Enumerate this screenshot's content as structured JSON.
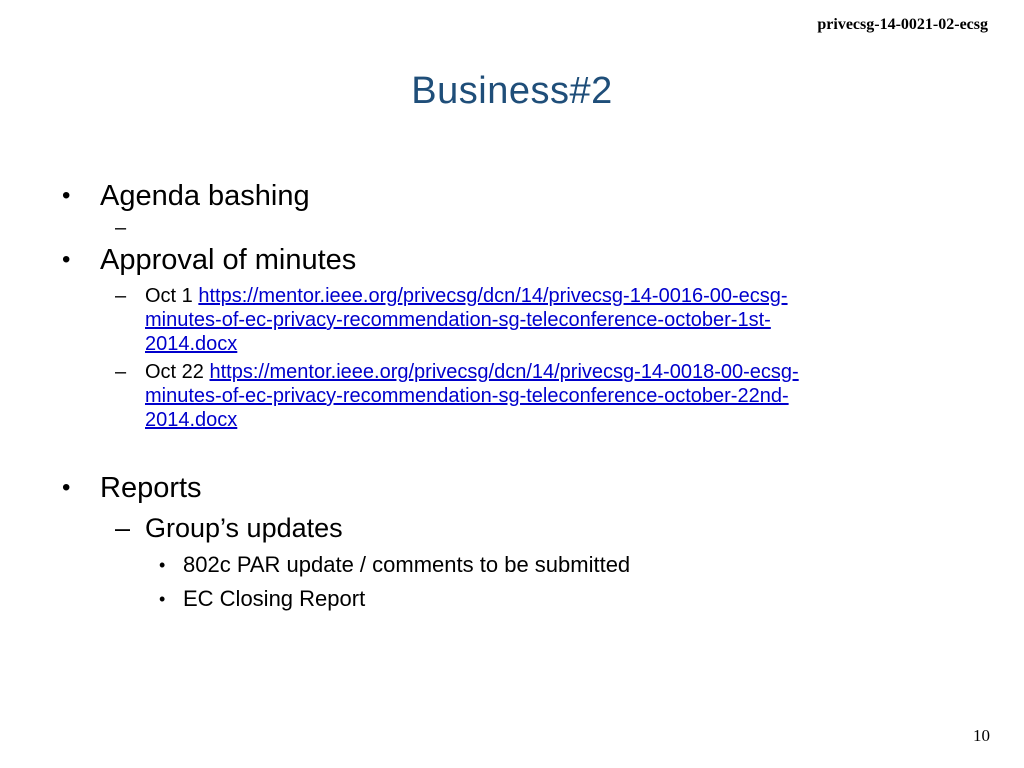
{
  "header": {
    "doc_id": "privecsg-14-0021-02-ecsg"
  },
  "slide": {
    "title": "Business#2",
    "bullets": [
      {
        "text": "Agenda bashing",
        "sub": [
          {
            "dash": "–",
            "text": ""
          }
        ]
      },
      {
        "text": "Approval of minutes",
        "sub": [
          {
            "dash": "–",
            "prefix": "Oct 1",
            "link_lines": [
              "https://mentor.ieee.org/privecsg/dcn/14/privecsg-14-0016-00-ecsg-",
              "minutes-of-ec-privacy-recommendation-sg-teleconference-october-1st-",
              "2014.docx"
            ]
          },
          {
            "dash": "–",
            "prefix": "Oct 22",
            "link_lines": [
              "https://mentor.ieee.org/privecsg/dcn/14/privecsg-14-0018-00-ecsg-",
              "minutes-of-ec-privacy-recommendation-sg-teleconference-october-22nd-",
              "2014.docx"
            ]
          }
        ]
      },
      {
        "text": "Reports",
        "sub": [
          {
            "dash": "–",
            "text": "Group’s updates",
            "sub": [
              {
                "text": "802c PAR update / comments to be submitted"
              },
              {
                "text": "EC Closing Report"
              }
            ]
          }
        ]
      }
    ]
  },
  "footer": {
    "page_number": "10"
  },
  "colors": {
    "title": "#1F4E79",
    "link": "#0000CC",
    "text": "#000000"
  }
}
